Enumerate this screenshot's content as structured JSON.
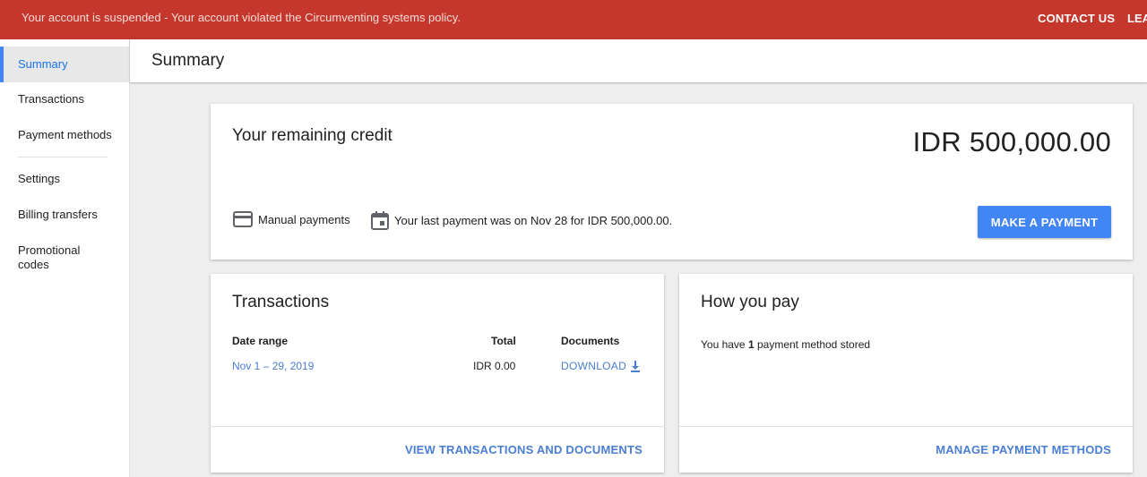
{
  "banner": {
    "message": "Your account is suspended - Your account violated the Circumventing systems policy.",
    "contact": "CONTACT US",
    "leave": "LEA"
  },
  "sidebar": {
    "items": [
      {
        "label": "Summary"
      },
      {
        "label": "Transactions"
      },
      {
        "label": "Payment methods"
      },
      {
        "label": "Settings"
      },
      {
        "label": "Billing transfers"
      },
      {
        "label": "Promotional codes"
      }
    ]
  },
  "header": {
    "title": "Summary"
  },
  "credit": {
    "title": "Your remaining credit",
    "amount": "IDR 500,000.00",
    "payment_type": "Manual payments",
    "last_payment": "Your last payment was on Nov 28 for IDR 500,000.00.",
    "button": "MAKE A PAYMENT"
  },
  "transactions": {
    "title": "Transactions",
    "columns": {
      "date": "Date range",
      "total": "Total",
      "documents": "Documents"
    },
    "row": {
      "date": "Nov 1 – 29, 2019",
      "total": "IDR 0.00",
      "documents": "DOWNLOAD"
    },
    "footer_link": "VIEW TRANSACTIONS AND DOCUMENTS"
  },
  "how_you_pay": {
    "title": "How you pay",
    "text_before": "You have ",
    "count": "1",
    "text_after": " payment method stored",
    "footer_link": "MANAGE PAYMENT METHODS"
  },
  "colors": {
    "banner": "#c5372c",
    "accent": "#4285f4",
    "link": "#4a7ed0"
  }
}
